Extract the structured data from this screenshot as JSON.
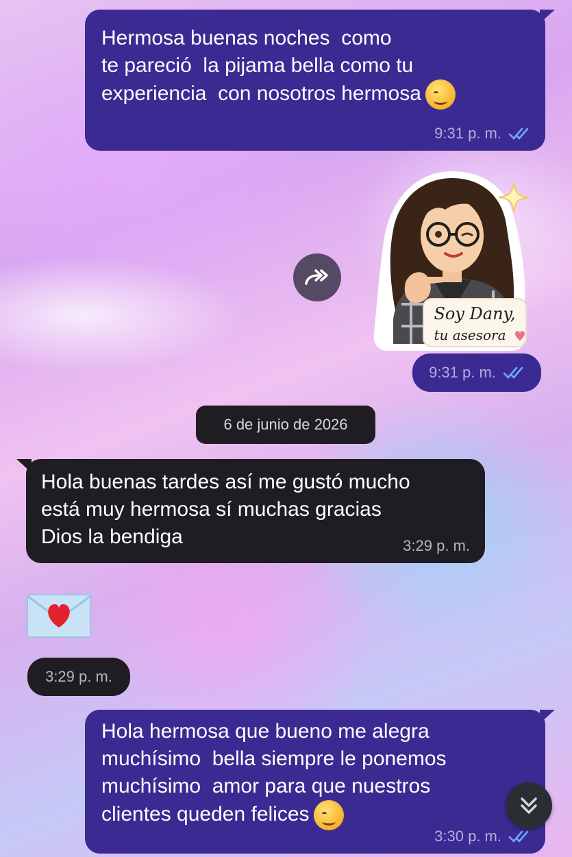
{
  "messages": {
    "m1": {
      "text": "Hermosa buenas noches  como\nte pareció  la pijama bella como tu\nexperiencia  con nosotros hermosa",
      "time": "9:31 p. m."
    },
    "sticker": {
      "line1": "Soy Dany,",
      "line2": "tu asesora",
      "time": "9:31 p. m."
    },
    "date_divider": "6 de junio de 2026",
    "m2": {
      "text": "Hola buenas tardes así me gustó mucho\nestá muy hermosa sí muchas gracias\nDios la bendiga",
      "time": "3:29 p. m."
    },
    "m3": {
      "time": "3:29 p. m."
    },
    "m4": {
      "text": "Hola hermosa que bueno me alegra\nmuchísimo  bella siempre le ponemos\nmuchísimo  amor para que nuestros\nclientes queden felices",
      "time": "3:30 p. m."
    }
  },
  "icons": {
    "read_receipt": "double-check-icon",
    "forward": "forward-icon",
    "scroll_down": "double-chevron-down-icon",
    "envelope_heart": "love-letter-icon"
  },
  "colors": {
    "outgoing_bubble": "#3c2a93",
    "incoming_bubble": "#1f1d22",
    "read_check": "#6fa8ff"
  }
}
